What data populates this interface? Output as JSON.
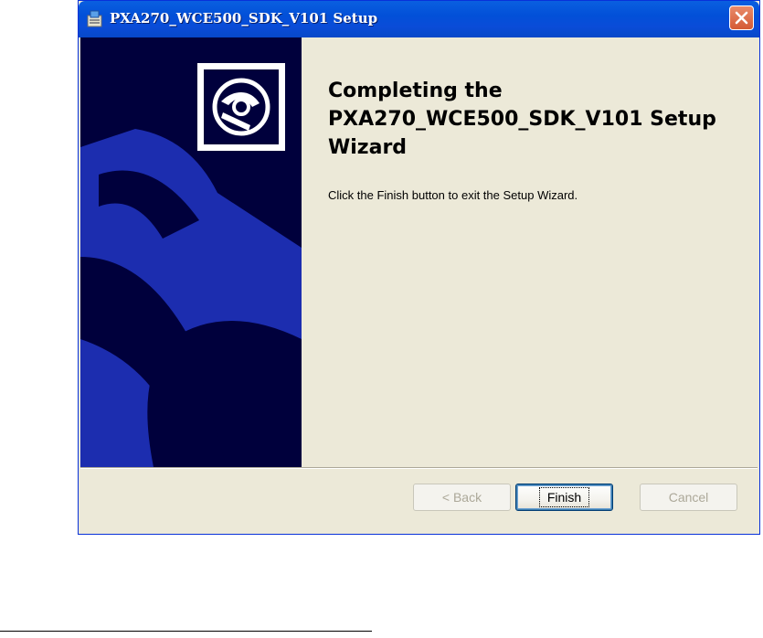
{
  "window": {
    "title": "PXA270_WCE500_SDK_V101 Setup"
  },
  "wizard": {
    "heading": "Completing the PXA270_WCE500_SDK_V101 Setup Wizard",
    "body": "Click the Finish button to exit the Setup Wizard."
  },
  "buttons": {
    "back": "< Back",
    "finish": "Finish",
    "cancel": "Cancel"
  },
  "icons": {
    "title": "installer-icon",
    "close": "close-icon",
    "banner": "cd-disc-icon"
  },
  "colors": {
    "titlebar": "#0a4cd8",
    "side_panel": "#00003c",
    "side_panel_shape": "#1d2fb5",
    "close": "#d45a34",
    "dialog_bg": "#ece9d8"
  }
}
